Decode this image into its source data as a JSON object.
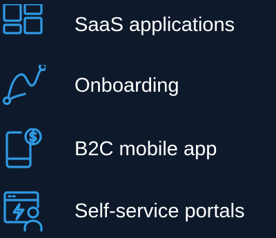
{
  "colors": {
    "background": "#0e1a2b",
    "icon": "#2f9be6",
    "text": "#ffffff"
  },
  "items": [
    {
      "label": "SaaS applications",
      "icon": "grid-dashboard-icon"
    },
    {
      "label": "Onboarding",
      "icon": "path-journey-icon"
    },
    {
      "label": "B2C mobile app",
      "icon": "mobile-payment-icon"
    },
    {
      "label": "Self-service portals",
      "icon": "portal-user-icon"
    }
  ]
}
